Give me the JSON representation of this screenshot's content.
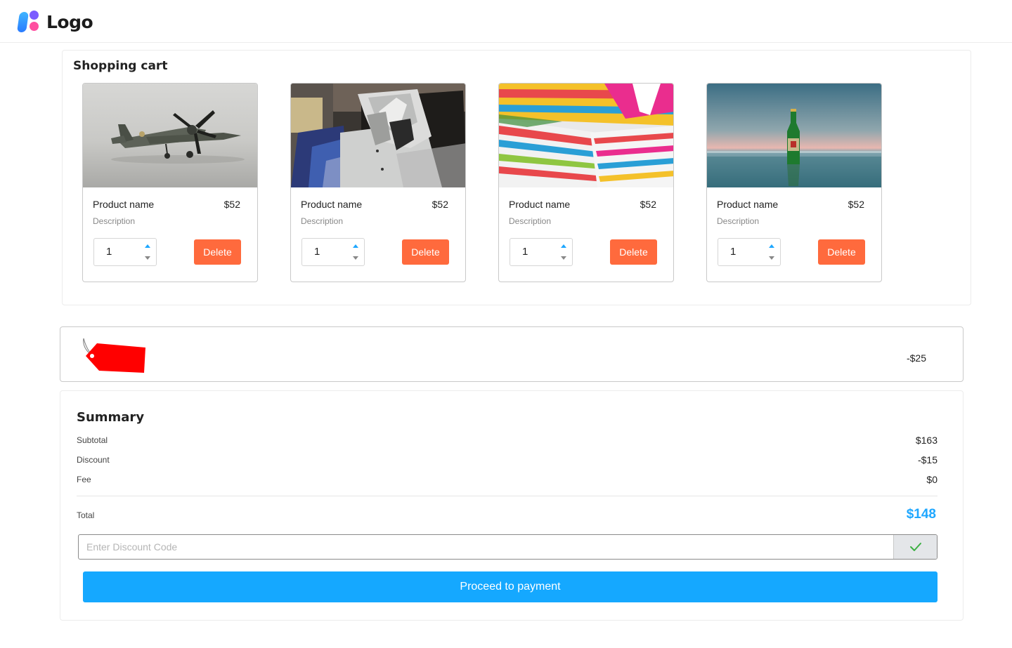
{
  "header": {
    "logo_text": "Logo"
  },
  "cart": {
    "title": "Shopping cart",
    "items": [
      {
        "name": "Product name",
        "price": "$52",
        "description": "Description",
        "quantity": "1",
        "delete_label": "Delete",
        "image": "model-airplane"
      },
      {
        "name": "Product name",
        "price": "$52",
        "description": "Description",
        "quantity": "1",
        "delete_label": "Delete",
        "image": "folded-shirts"
      },
      {
        "name": "Product name",
        "price": "$52",
        "description": "Description",
        "quantity": "1",
        "delete_label": "Delete",
        "image": "striped-pillows"
      },
      {
        "name": "Product name",
        "price": "$52",
        "description": "Description",
        "quantity": "1",
        "delete_label": "Delete",
        "image": "bottle-on-sea"
      }
    ]
  },
  "discount_strip": {
    "icon": "price-tag-icon",
    "amount": "-$25"
  },
  "summary": {
    "title": "Summary",
    "rows": [
      {
        "label": "Subtotal",
        "value": "$163"
      },
      {
        "label": "Discount",
        "value": "-$15"
      },
      {
        "label": "Fee",
        "value": "$0"
      }
    ],
    "total_label": "Total",
    "total_value": "$148",
    "discount_code_placeholder": "Enter Discount Code",
    "discount_code_value": "",
    "proceed_label": "Proceed to payment"
  },
  "colors": {
    "accent": "#15a8ff",
    "delete": "#ff6a3d",
    "tag": "#ff0000",
    "check": "#3cb043"
  }
}
